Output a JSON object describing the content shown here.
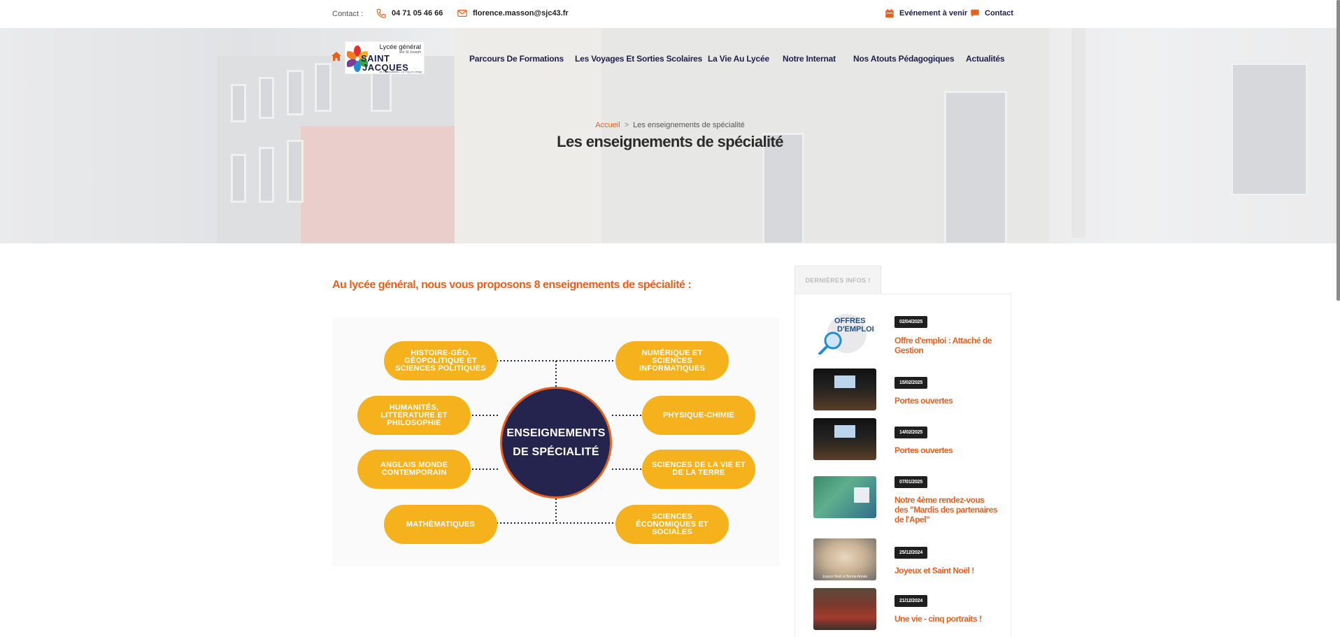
{
  "topbar": {
    "contact_label": "Contact :",
    "phone": "04 71 05 46 66",
    "email": "florence.masson@sjc43.fr",
    "events_label": "Evénement à venir",
    "contact_link": "Contact",
    "icons": {
      "phone": "phone-icon",
      "email": "envelope-icon",
      "events": "calendar-icon",
      "contact": "chat-bubble-icon"
    },
    "accent_color": "#e8601c"
  },
  "logo": {
    "line1": "Lycée général",
    "line2": "site St Joseph",
    "line3": "SAINT",
    "line4": "JACQUES",
    "line5": "de Compostelle • Le Puy-en-Velay"
  },
  "nav": {
    "items": [
      "Parcours De Formations",
      "Les Voyages Et Sorties Scolaires",
      "La Vie Au Lycée",
      "Notre Internat",
      "Nos Atouts Pédagogiques",
      "Actualités"
    ]
  },
  "breadcrumb": {
    "home": "Accueil",
    "separator": ">",
    "current": "Les enseignements de spécialité"
  },
  "page_title": "Les enseignements de spécialité",
  "main": {
    "intro": "Au lycée général, nous vous proposons 8 enseignements de spécialité :",
    "diagram": {
      "center_line1": "ENSEIGNEMENTS",
      "center_line2": "DE SPÉCIALITÉ",
      "left": [
        "HISTOIRE-GÉO, GÉOPOLITIQUE ET SCIENCES POLITIQUES",
        "HUMANITÉS, LITTÉRATURE ET PHILOSOPHIE",
        "ANGLAIS MONDE CONTEMPORAIN",
        "MATHÉMATIQUES"
      ],
      "right": [
        "NUMÉRIQUE ET SCIENCES INFORMATIQUES",
        "PHYSIQUE-CHIMIE",
        "SCIENCES DE LA VIE ET DE LA TERRE",
        "SCIENCES ÉCONOMIQUES ET SOCIALES"
      ],
      "colors": {
        "pill": "#f6b21c",
        "center": "#24244e",
        "border": "#e8601c"
      }
    }
  },
  "sidebar": {
    "tab_label": "DERNIÈRES INFOS !",
    "news": [
      {
        "date": "02/04/2025",
        "title": "Offre d'emploi : Attaché de Gestion",
        "thumb_line1": "OFFRES",
        "thumb_line2": "D'EMPLOI"
      },
      {
        "date": "15/02/2025",
        "title": "Portes ouvertes"
      },
      {
        "date": "14/02/2025",
        "title": "Portes ouvertes"
      },
      {
        "date": "07/01/2025",
        "title": "Notre 4ème rendez-vous des \"Mardis des partenaires de l'Apel\""
      },
      {
        "date": "25/12/2024",
        "title": "Joyeux et Saint Noël !",
        "thumb_caption": "Joyeux Noël et Bonne Année"
      },
      {
        "date": "21/12/2024",
        "title": "Une vie - cinq portraits !"
      }
    ]
  }
}
